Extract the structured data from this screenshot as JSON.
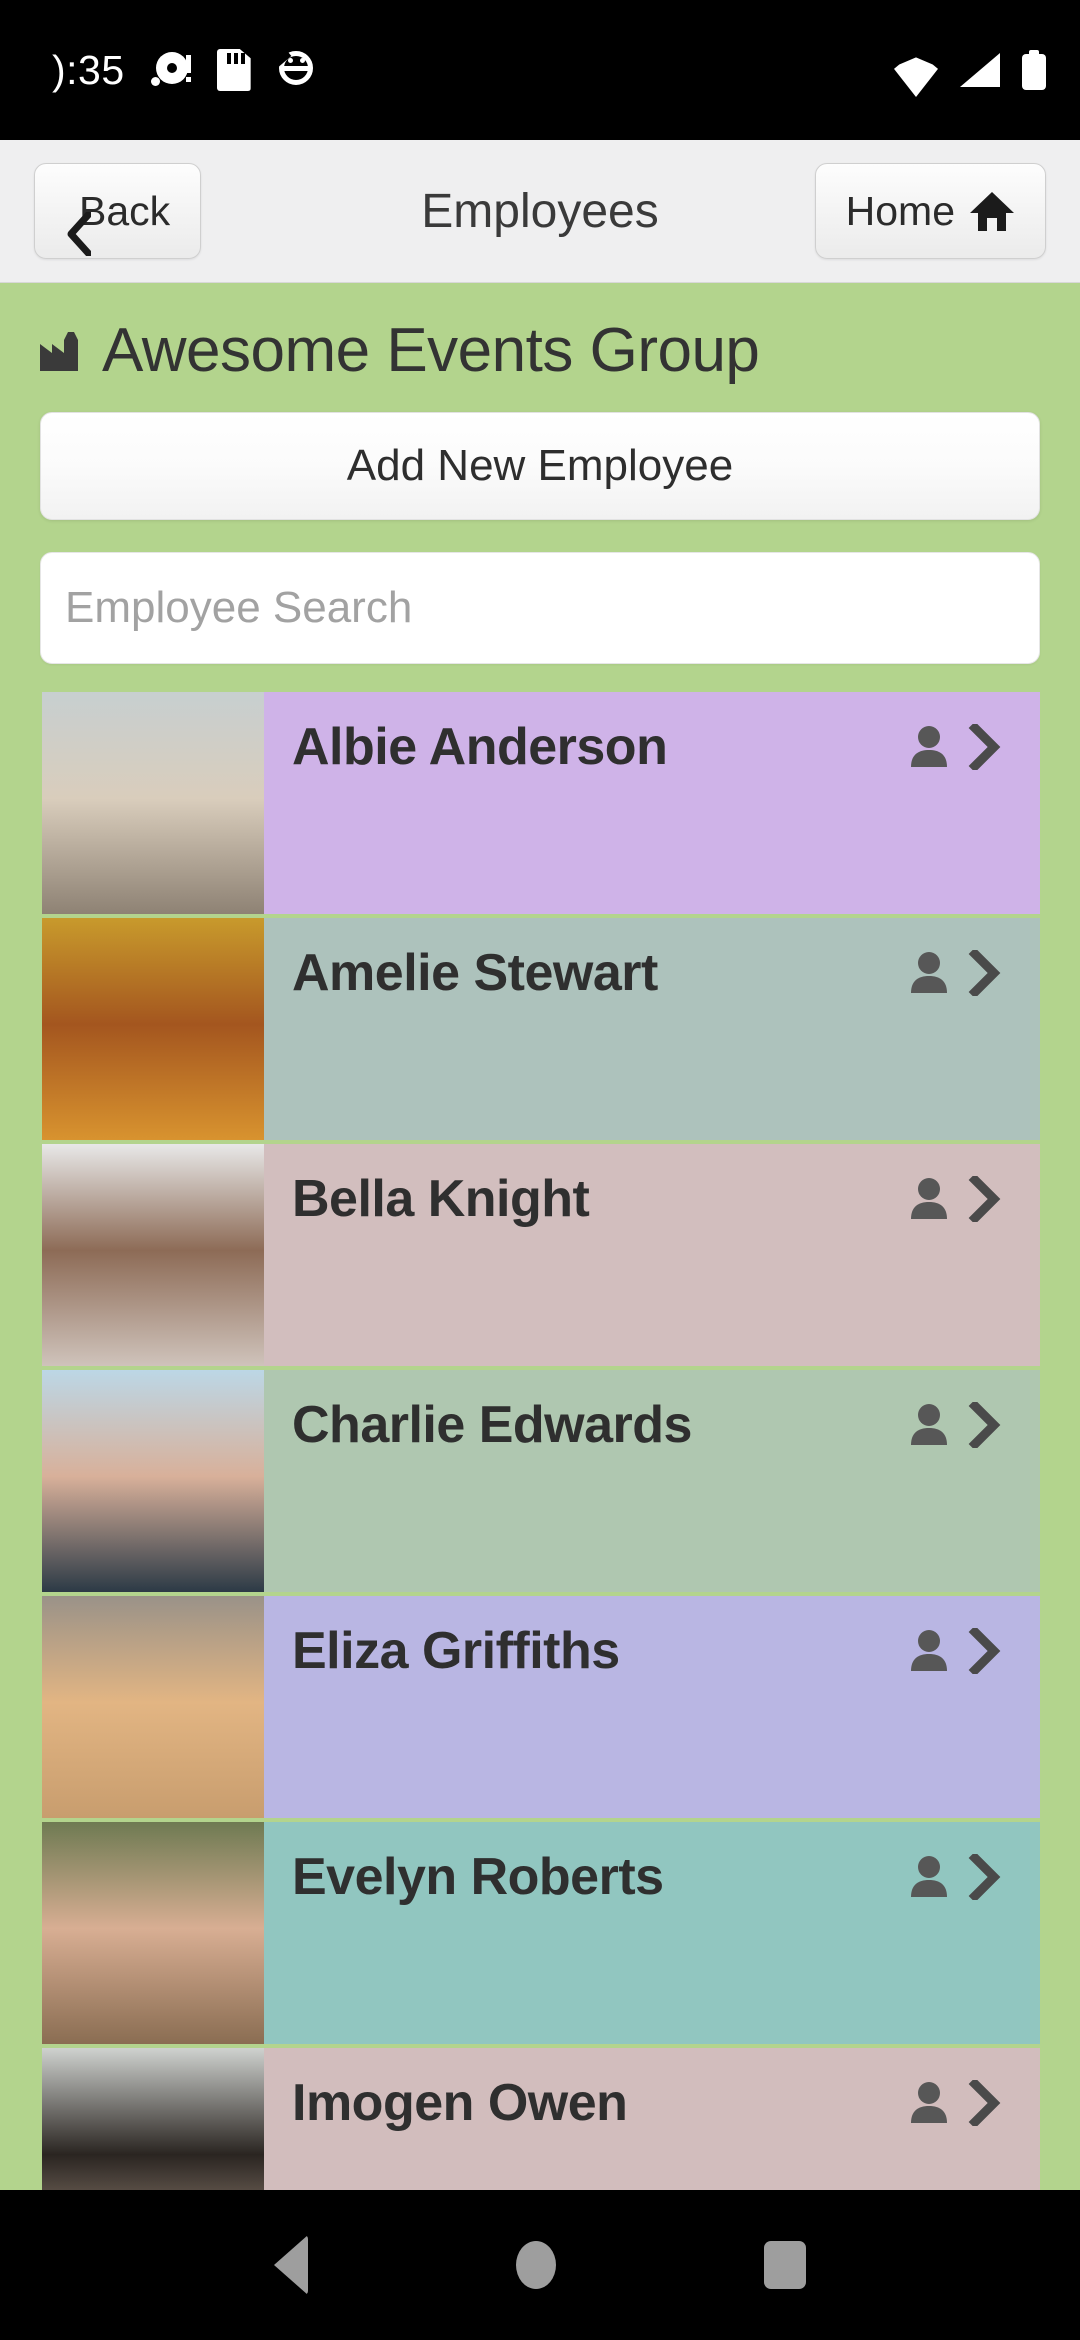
{
  "statusbar": {
    "time": "):35",
    "icons": [
      "record-disc-icon",
      "sd-card-icon",
      "android-debug-icon"
    ],
    "right_icons": [
      "wifi-icon",
      "cellular-signal-icon",
      "battery-icon"
    ]
  },
  "navbar": {
    "back_label": "Back",
    "title": "Employees",
    "home_label": "Home"
  },
  "header": {
    "org_name": "Awesome Events Group",
    "org_icon": "factory-icon"
  },
  "actions": {
    "add_employee_label": "Add New Employee"
  },
  "search": {
    "placeholder": "Employee Search",
    "value": ""
  },
  "colors": {
    "page_background": "#b3d48d",
    "navbar_background": "#efeff0",
    "name_text": "#2f2f2f",
    "icon_gray": "#575757"
  },
  "employees": [
    {
      "name": "Albie Anderson",
      "row_color": "#cfb3e8",
      "thumb_top": "#c7cfd0",
      "thumb_mid": "#d9cdbc",
      "thumb_bot": "#8e8274"
    },
    {
      "name": "Amelie Stewart",
      "row_color": "#adc2bc",
      "thumb_top": "#c89a2c",
      "thumb_mid": "#a4561f",
      "thumb_bot": "#d8932f"
    },
    {
      "name": "Bella Knight",
      "row_color": "#d2bebe",
      "thumb_top": "#e8e8e8",
      "thumb_mid": "#8d6b56",
      "thumb_bot": "#cfc3bb"
    },
    {
      "name": "Charlie Edwards",
      "row_color": "#afc7b0",
      "thumb_top": "#bcd7e6",
      "thumb_mid": "#d8b09a",
      "thumb_bot": "#2c3a46"
    },
    {
      "name": "Eliza Griffiths",
      "row_color": "#b9b6e3",
      "thumb_top": "#9a9288",
      "thumb_mid": "#e2b583",
      "thumb_bot": "#c89d6e"
    },
    {
      "name": "Evelyn Roberts",
      "row_color": "#91c6c0",
      "thumb_top": "#6e7a52",
      "thumb_mid": "#d8ae93",
      "thumb_bot": "#8a6d52"
    },
    {
      "name": "Imogen Owen",
      "row_color": "#d2bdbd",
      "thumb_top": "#cfd2cf",
      "thumb_mid": "#2a2521",
      "thumb_bot": "#b9a392"
    }
  ],
  "android_nav": {
    "back": "back-triangle-icon",
    "home": "home-circle-icon",
    "recents": "recents-square-icon"
  }
}
